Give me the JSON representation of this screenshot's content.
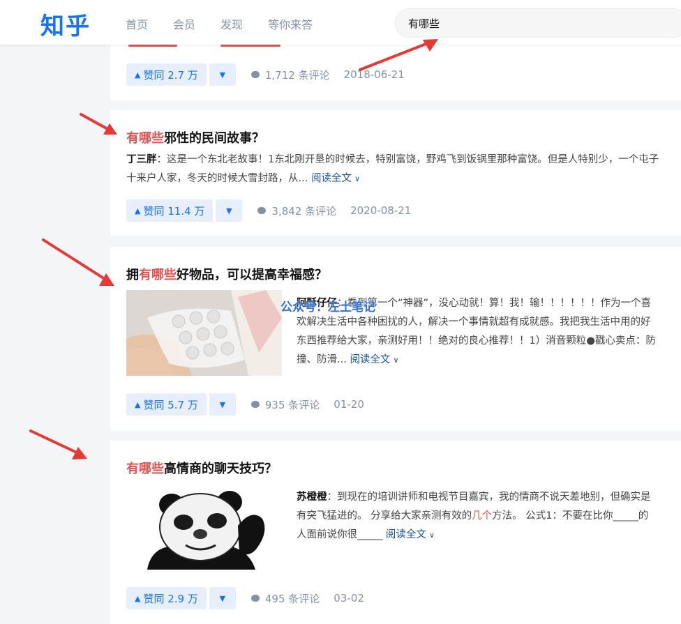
{
  "header": {
    "logo": "知乎",
    "nav": [
      "首页",
      "会员",
      "发现",
      "等你来答"
    ],
    "search_value": "有哪些"
  },
  "colors": {
    "brand": "#1772f6",
    "highlight": "#e0524e",
    "annotation_arrow": "#e53935"
  },
  "watermark": "公众号：左土笔记",
  "cards": [
    {
      "vote": "赞同 2.7 万",
      "comments": "1,712 条评论",
      "date": "2018-06-21"
    },
    {
      "title_hl": "有哪些",
      "title_rest": "邪性的民间故事？",
      "author": "丁三胖",
      "excerpt": "：这是一个东北老故事！1东北刚开垦的时候去，特别富饶，野鸡飞到饭锅里那种富饶。但是人特别少，一个屯子十来户人家，冬天的时候大雪封路，从...",
      "read_more": "阅读全文",
      "vote": "赞同 11.4 万",
      "comments": "3,842 条评论",
      "date": "2020-08-21"
    },
    {
      "title_pre": "拥",
      "title_hl": "有哪些",
      "title_rest": "好物品，可以提高幸福感？",
      "author": "阿酥仔仔",
      "excerpt": "：看到第一个“神器”，没心动就！算！我！输！！！！！！作为一个喜欢解决生活中各种困扰的人，解决一个事情就超有成就感。我把我生活中用的好东西推荐给大家，亲测好用！！绝对的良心推荐！！1）消音颗粒●戳心卖点：防撞、防滑...",
      "read_more": "阅读全文",
      "vote": "赞同 5.7 万",
      "comments": "935 条评论",
      "date": "01-20"
    },
    {
      "title_hl": "有哪些",
      "title_rest": "高情商的聊天技巧？",
      "author": "苏橙橙",
      "excerpt_a": "：到现在的培训讲师和电视节目嘉宾，我的情商不说天差地别，但确实是有突飞猛进的。 分享给大家亲测有效的",
      "excerpt_hl": "几个",
      "excerpt_b": "方法。 公式1：不要在比你_____的人面前说你很_____",
      "read_more": "阅读全文",
      "vote": "赞同 2.9 万",
      "comments": "495 条评论",
      "date": "03-02"
    }
  ]
}
